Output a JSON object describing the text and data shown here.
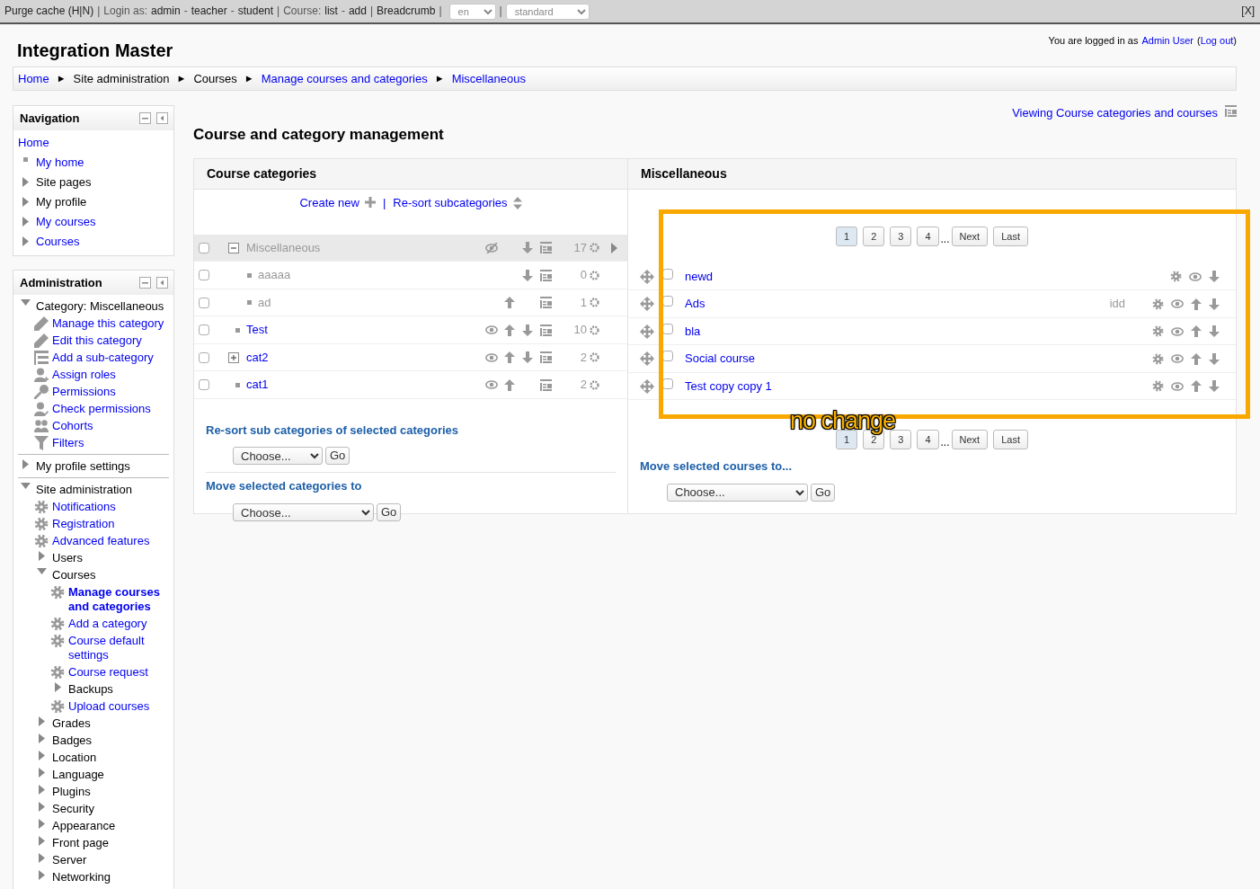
{
  "admin_bar": {
    "purge": "Purge cache (H|N)",
    "separator": "|",
    "login_label": "Login as:",
    "login_links": [
      "admin",
      "teacher",
      "student"
    ],
    "joiner": "-",
    "course_label": "Course:",
    "course_links": [
      "list",
      "add"
    ],
    "breadcrumb_link": "Breadcrumb",
    "language": "en",
    "theme": "standard",
    "close": "[X]"
  },
  "site_title": "Integration Master",
  "login_info": {
    "prefix": "You are logged in as",
    "user": "Admin User",
    "open": "(",
    "logout": "Log out",
    "close": ")"
  },
  "breadcrumb": {
    "separator": "►",
    "items": [
      {
        "label": "Home",
        "link": true
      },
      {
        "label": "Site administration",
        "link": false
      },
      {
        "label": "Courses",
        "link": false
      },
      {
        "label": "Manage courses and categories",
        "link": true
      },
      {
        "label": "Miscellaneous",
        "link": true
      }
    ]
  },
  "navigation": {
    "title": "Navigation",
    "items": [
      {
        "label": "Home",
        "kind": "root",
        "link": true
      },
      {
        "label": "My home",
        "kind": "leaf",
        "link": true
      },
      {
        "label": "Site pages",
        "kind": "branch",
        "link": false,
        "expanded": false
      },
      {
        "label": "My profile",
        "kind": "branch",
        "link": false,
        "expanded": false
      },
      {
        "label": "My courses",
        "kind": "branch",
        "link": true,
        "expanded": false
      },
      {
        "label": "Courses",
        "kind": "branch",
        "link": true,
        "expanded": false
      }
    ]
  },
  "administration": {
    "title": "Administration",
    "sections": [
      {
        "items": [
          {
            "label": "Category: Miscellaneous",
            "kind": "branch",
            "link": false,
            "expanded": true,
            "children": [
              {
                "label": "Manage this category",
                "kind": "edit",
                "link": true
              },
              {
                "label": "Edit this category",
                "kind": "edit",
                "link": true
              },
              {
                "label": "Add a sub-category",
                "kind": "subcategory",
                "link": true
              },
              {
                "label": "Assign roles",
                "kind": "role",
                "link": true
              },
              {
                "label": "Permissions",
                "kind": "key",
                "link": true
              },
              {
                "label": "Check permissions",
                "kind": "check",
                "link": true
              },
              {
                "label": "Cohorts",
                "kind": "cohort",
                "link": true
              },
              {
                "label": "Filters",
                "kind": "filter",
                "link": true
              }
            ]
          }
        ]
      },
      {
        "items": [
          {
            "label": "My profile settings",
            "kind": "branch",
            "link": false,
            "expanded": false
          }
        ]
      },
      {
        "items": [
          {
            "label": "Site administration",
            "kind": "branch",
            "link": false,
            "expanded": true,
            "children": [
              {
                "label": "Notifications",
                "kind": "setting",
                "link": true
              },
              {
                "label": "Registration",
                "kind": "setting",
                "link": true
              },
              {
                "label": "Advanced features",
                "kind": "setting",
                "link": true
              },
              {
                "label": "Users",
                "kind": "branch",
                "link": false,
                "expanded": false
              },
              {
                "label": "Courses",
                "kind": "branch",
                "link": false,
                "expanded": true,
                "children": [
                  {
                    "label": "Manage courses and categories",
                    "kind": "setting",
                    "link": true,
                    "current": true
                  },
                  {
                    "label": "Add a category",
                    "kind": "setting",
                    "link": true
                  },
                  {
                    "label": "Course default settings",
                    "kind": "setting",
                    "link": true
                  },
                  {
                    "label": "Course request",
                    "kind": "setting",
                    "link": true
                  },
                  {
                    "label": "Backups",
                    "kind": "branch",
                    "link": false,
                    "expanded": false
                  },
                  {
                    "label": "Upload courses",
                    "kind": "setting",
                    "link": true
                  }
                ]
              },
              {
                "label": "Grades",
                "kind": "branch",
                "link": false,
                "expanded": false
              },
              {
                "label": "Badges",
                "kind": "branch",
                "link": false,
                "expanded": false
              },
              {
                "label": "Location",
                "kind": "branch",
                "link": false,
                "expanded": false
              },
              {
                "label": "Language",
                "kind": "branch",
                "link": false,
                "expanded": false
              },
              {
                "label": "Plugins",
                "kind": "branch",
                "link": false,
                "expanded": false
              },
              {
                "label": "Security",
                "kind": "branch",
                "link": false,
                "expanded": false
              },
              {
                "label": "Appearance",
                "kind": "branch",
                "link": false,
                "expanded": false
              },
              {
                "label": "Front page",
                "kind": "branch",
                "link": false,
                "expanded": false
              },
              {
                "label": "Server",
                "kind": "branch",
                "link": false,
                "expanded": false
              },
              {
                "label": "Networking",
                "kind": "branch",
                "link": false,
                "expanded": false
              }
            ]
          }
        ]
      }
    ]
  },
  "view_mode_link": "Viewing Course categories and courses",
  "heading": "Course and category management",
  "categories_panel": {
    "title": "Course categories",
    "separator": "|",
    "actions": [
      {
        "label": "Create new",
        "kind": "create"
      },
      {
        "label": "Re-sort subcategories",
        "kind": "sort"
      }
    ],
    "rows": [
      {
        "name": "Miscellaneous",
        "selected": true,
        "checked": false,
        "hidden": true,
        "expanded": true,
        "visibility_toggle": true,
        "can_move_up": false,
        "can_move_down": true,
        "count": "17",
        "children": [
          {
            "name": "aaaaa",
            "selected": false,
            "checked": false,
            "hidden": true,
            "visibility_toggle": false,
            "can_move_up": false,
            "can_move_down": true,
            "count": "0"
          },
          {
            "name": "ad",
            "selected": false,
            "checked": false,
            "hidden": true,
            "visibility_toggle": false,
            "can_move_up": true,
            "can_move_down": false,
            "count": "1"
          }
        ]
      },
      {
        "name": "Test",
        "selected": false,
        "checked": false,
        "hidden": false,
        "visibility_toggle": true,
        "can_move_up": true,
        "can_move_down": true,
        "count": "10"
      },
      {
        "name": "cat2",
        "selected": false,
        "checked": false,
        "hidden": false,
        "expanded": false,
        "visibility_toggle": true,
        "can_move_up": true,
        "can_move_down": true,
        "count": "2"
      },
      {
        "name": "cat1",
        "selected": false,
        "checked": false,
        "hidden": false,
        "visibility_toggle": true,
        "can_move_up": true,
        "can_move_down": false,
        "count": "2"
      }
    ],
    "forms": [
      {
        "title": "Re-sort sub categories of selected categories",
        "select": "Choose...",
        "button": "Go"
      },
      {
        "title": "Move selected categories to",
        "select": "Choose...",
        "button": "Go"
      }
    ]
  },
  "courses_panel": {
    "title": "Miscellaneous",
    "pagination": {
      "pages": [
        {
          "label": "1",
          "selected": true
        },
        {
          "label": "2",
          "selected": false
        },
        {
          "label": "3",
          "selected": false
        },
        {
          "label": "4",
          "selected": false
        }
      ],
      "ellipsis": "...",
      "next": "Next",
      "last": "Last"
    },
    "courses": [
      {
        "name": "newd",
        "checked": false,
        "can_move_up": false,
        "can_move_down": true
      },
      {
        "name": "Ads",
        "idnumber": "idd",
        "checked": false,
        "can_move_up": true,
        "can_move_down": true
      },
      {
        "name": "bla",
        "checked": false,
        "can_move_up": true,
        "can_move_down": true
      },
      {
        "name": "Social course",
        "checked": false,
        "can_move_up": true,
        "can_move_down": true
      },
      {
        "name": "Test copy copy 1",
        "checked": false,
        "can_move_up": true,
        "can_move_down": true
      }
    ],
    "bottom_pagination": {
      "pages": [
        {
          "label": "1",
          "selected": true
        },
        {
          "label": "2",
          "selected": false
        },
        {
          "label": "3",
          "selected": false
        },
        {
          "label": "4",
          "selected": false
        }
      ],
      "ellipsis": "...",
      "next": "Next",
      "last": "Last"
    },
    "form": {
      "title": "Move selected courses to...",
      "select": "Choose...",
      "button": "Go"
    }
  },
  "annotation": {
    "text": "no change"
  }
}
